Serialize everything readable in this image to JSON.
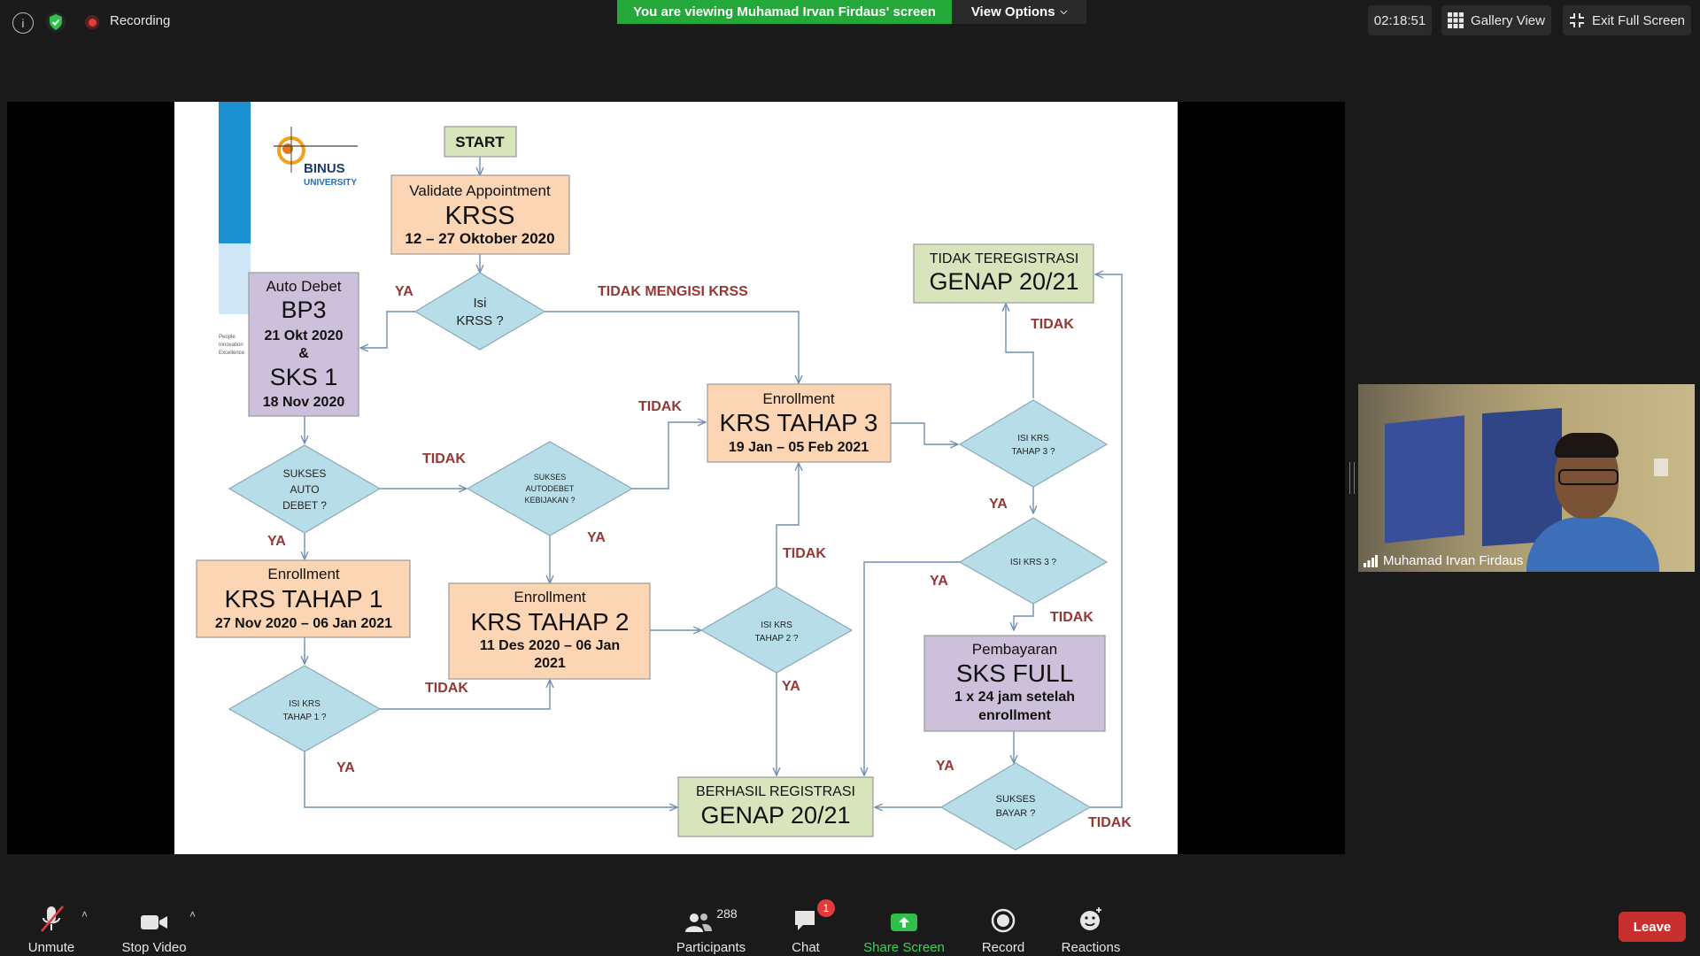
{
  "meeting": {
    "recording_label": "Recording",
    "viewing_banner": "You are viewing Muhamad Irvan Firdaus' screen",
    "view_options_label": "View Options",
    "timer": "02:18:51",
    "gallery_view_label": "Gallery View",
    "exit_fullscreen_label": "Exit Full Screen",
    "participant_name": "Muhamad Irvan Firdaus"
  },
  "toolbar": {
    "unmute_label": "Unmute",
    "stop_video_label": "Stop Video",
    "participants_label": "Participants",
    "participants_count": "288",
    "chat_label": "Chat",
    "chat_badge": "1",
    "share_label": "Share Screen",
    "record_label": "Record",
    "reactions_label": "Reactions",
    "leave_label": "Leave"
  },
  "slide": {
    "logo_text": "BINUS",
    "logo_sub": "UNIVERSITY",
    "side_text": [
      "People",
      "Innovation",
      "Excellence"
    ],
    "start": "START",
    "validate": {
      "top": "Validate Appointment",
      "big": "KRSS",
      "date": "12  – 27 Oktober 2020"
    },
    "isi_krss": [
      "Isi",
      "KRSS ?"
    ],
    "autodebet": {
      "top": "Auto Debet",
      "big1": "BP3",
      "date1": "21 Okt 2020",
      "amp": "&",
      "big2": "SKS 1",
      "date2": "18 Nov 2020"
    },
    "sukses_auto": [
      "SUKSES",
      "AUTO",
      "DEBET ?"
    ],
    "sukses_kebijakan": [
      "SUKSES",
      "AUTODEBET",
      "KEBIJAKAN ?"
    ],
    "krs1": {
      "top": "Enrollment",
      "big": "KRS TAHAP 1",
      "date": "27 Nov 2020 – 06 Jan 2021"
    },
    "krs2": {
      "top": "Enrollment",
      "big": "KRS TAHAP 2",
      "date1": "11 Des 2020 – 06 Jan",
      "date2": "2021"
    },
    "krs3": {
      "top": "Enrollment",
      "big": "KRS TAHAP 3",
      "date": "19 Jan – 05 Feb 2021"
    },
    "isi_krs1": [
      "ISI KRS",
      "TAHAP 1 ?"
    ],
    "isi_krs2": [
      "ISI KRS",
      "TAHAP 2 ?"
    ],
    "isi_krs3_tahap": [
      "ISI KRS",
      "TAHAP 3 ?"
    ],
    "isi_krs3": "ISI KRS 3 ?",
    "tidak_teregistrasi": {
      "top": "TIDAK TEREGISTRASI",
      "big": "GENAP 20/21"
    },
    "berhasil": {
      "top": "BERHASIL REGISTRASI",
      "big": "GENAP 20/21"
    },
    "pembayaran": {
      "top": "Pembayaran",
      "big": "SKS FULL",
      "line1": "1 x 24 jam setelah",
      "line2": "enrollment"
    },
    "sukses_bayar": [
      "SUKSES",
      "BAYAR ?"
    ],
    "labels": {
      "ya": "YA",
      "tidak": "TIDAK",
      "tidak_mengisi": "TIDAK MENGISI KRSS"
    }
  },
  "colors": {
    "diamond": "#b7dde8",
    "peach": "#fcd5b4",
    "lavender": "#ccc0da",
    "green_box": "#d7e4bc",
    "start_box": "#d7e4bc",
    "label_red": "#953735",
    "banner_green": "#24a839",
    "leave_red": "#c8302f"
  }
}
